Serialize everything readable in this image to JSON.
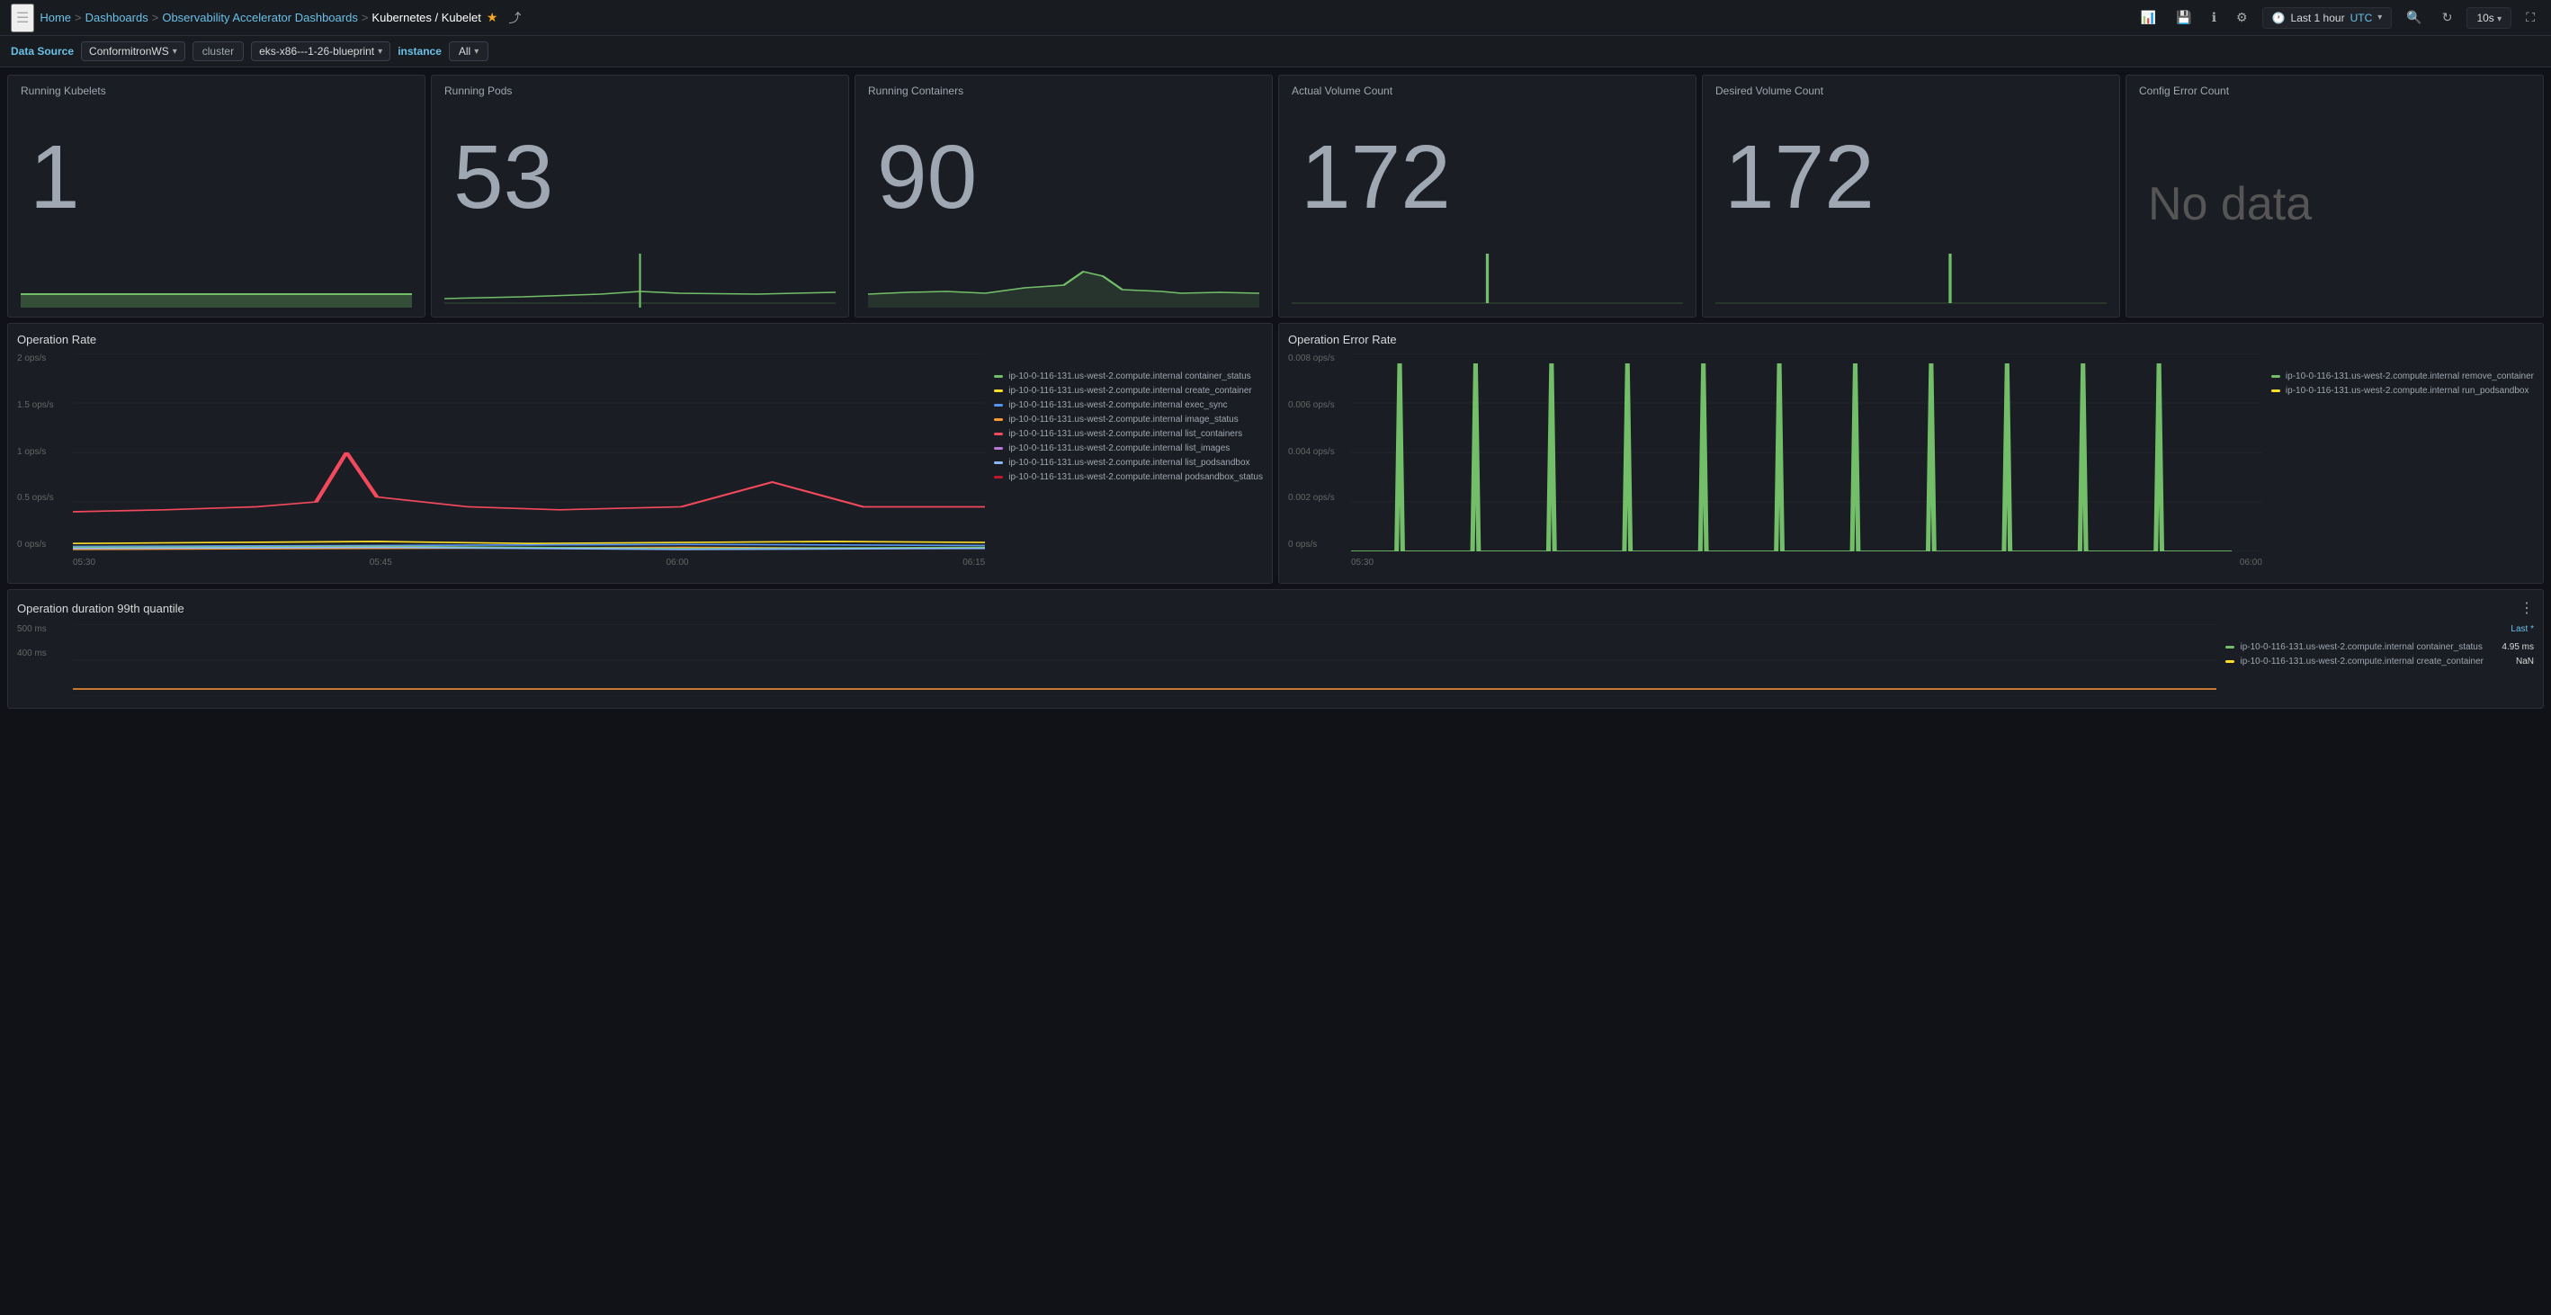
{
  "nav": {
    "menu_label": "☰",
    "breadcrumbs": [
      {
        "label": "Home",
        "href": "#"
      },
      {
        "label": "Dashboards",
        "href": "#"
      },
      {
        "label": "Observability Accelerator Dashboards",
        "href": "#"
      },
      {
        "label": "Kubernetes / Kubelet",
        "href": "#",
        "active": true
      }
    ],
    "time_range": "Last 1 hour",
    "timezone": "UTC",
    "refresh_rate": "10s",
    "icons": [
      "bar-chart",
      "save",
      "info",
      "settings",
      "history",
      "zoom-out",
      "refresh",
      "expand"
    ]
  },
  "toolbar": {
    "data_source_label": "Data Source",
    "data_source_value": "ConformitronWS",
    "cluster_label": "cluster",
    "cluster_value": "eks-x86---1-26-blueprint",
    "instance_label": "instance",
    "instance_value": "All"
  },
  "stat_panels": [
    {
      "title": "Running Kubelets",
      "value": "1",
      "has_sparkline": true,
      "sparkline_color": "#73bf69"
    },
    {
      "title": "Running Pods",
      "value": "53",
      "has_sparkline": true,
      "sparkline_color": "#73bf69"
    },
    {
      "title": "Running Containers",
      "value": "90",
      "has_sparkline": true,
      "sparkline_color": "#73bf69"
    },
    {
      "title": "Actual Volume Count",
      "value": "172",
      "has_sparkline": true,
      "sparkline_color": "#73bf69"
    },
    {
      "title": "Desired Volume Count",
      "value": "172",
      "has_sparkline": true,
      "sparkline_color": "#73bf69"
    },
    {
      "title": "Config Error Count",
      "value": "No data",
      "has_sparkline": false,
      "sparkline_color": null
    }
  ],
  "operation_rate_panel": {
    "title": "Operation Rate",
    "y_labels": [
      "2 ops/s",
      "1.5 ops/s",
      "1 ops/s",
      "0.5 ops/s",
      "0 ops/s"
    ],
    "x_labels": [
      "05:30",
      "05:45",
      "06:00",
      "06:15"
    ],
    "legend": [
      {
        "color": "#73bf69",
        "label": "ip-10-0-116-131.us-west-2.compute.internal container_status"
      },
      {
        "color": "#fade2a",
        "label": "ip-10-0-116-131.us-west-2.compute.internal create_container"
      },
      {
        "color": "#5794f2",
        "label": "ip-10-0-116-131.us-west-2.compute.internal exec_sync"
      },
      {
        "color": "#ff9830",
        "label": "ip-10-0-116-131.us-west-2.compute.internal image_status"
      },
      {
        "color": "#f2495c",
        "label": "ip-10-0-116-131.us-west-2.compute.internal list_containers"
      },
      {
        "color": "#b877d9",
        "label": "ip-10-0-116-131.us-west-2.compute.internal list_images"
      },
      {
        "color": "#8ab8ff",
        "label": "ip-10-0-116-131.us-west-2.compute.internal list_podsandbox"
      },
      {
        "color": "#c4162a",
        "label": "ip-10-0-116-131.us-west-2.compute.internal podsandbox_status"
      }
    ]
  },
  "operation_error_rate_panel": {
    "title": "Operation Error Rate",
    "y_labels": [
      "0.008 ops/s",
      "0.006 ops/s",
      "0.004 ops/s",
      "0.002 ops/s",
      "0 ops/s"
    ],
    "x_labels": [
      "05:30",
      "06:00"
    ],
    "legend": [
      {
        "color": "#73bf69",
        "label": "ip-10-0-116-131.us-west-2.compute.internal remove_container"
      },
      {
        "color": "#fade2a",
        "label": "ip-10-0-116-131.us-west-2.compute.internal run_podsandbox"
      }
    ]
  },
  "operation_duration_panel": {
    "title": "Operation duration 99th quantile",
    "y_labels": [
      "500 ms",
      "400 ms"
    ],
    "last_label": "Last *",
    "legend": [
      {
        "color": "#73bf69",
        "label": "ip-10-0-116-131.us-west-2.compute.internal container_status",
        "value": "4.95 ms"
      },
      {
        "color": "#fade2a",
        "label": "ip-10-0-116-131.us-west-2.compute.internal create_container",
        "value": "NaN"
      }
    ],
    "menu_icon": "⋮"
  }
}
